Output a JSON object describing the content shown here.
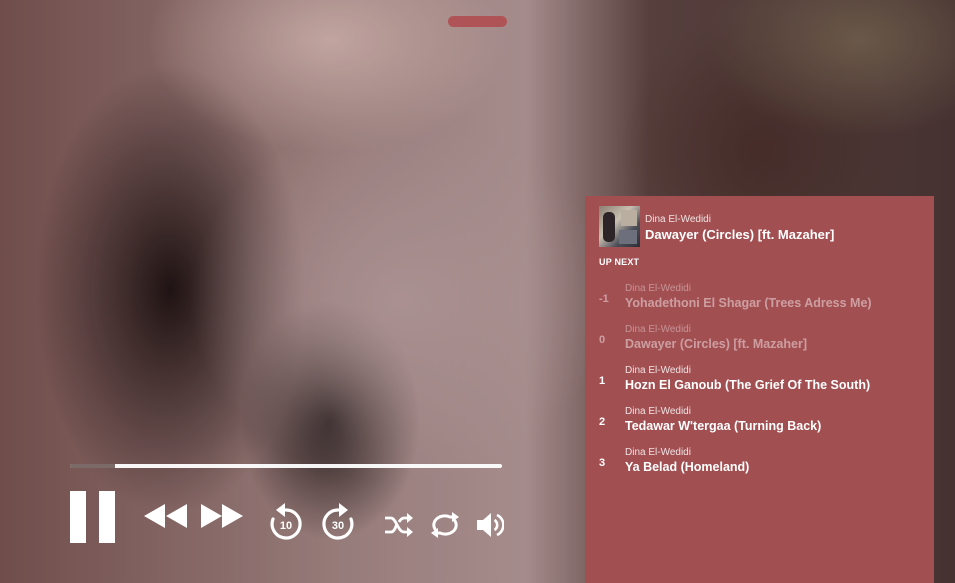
{
  "colors": {
    "accent": "#a24f52",
    "handle": "#b05356",
    "progress_track": "#ffffff",
    "progress_played": "#7c6a68"
  },
  "player": {
    "progress_fraction": 0.105,
    "controls": {
      "pause": "pause-icon",
      "rewind": "rewind-icon",
      "fast_forward": "fast-forward-icon",
      "skip_back": {
        "icon": "replay-icon",
        "label": "10"
      },
      "skip_forward": {
        "icon": "forward-icon",
        "label": "30"
      },
      "shuffle": "shuffle-icon",
      "repeat": "repeat-icon",
      "volume": "volume-icon"
    }
  },
  "now_playing": {
    "artist": "Dina El-Wedidi",
    "title": "Dawayer (Circles) [ft. Mazaher]"
  },
  "queue": {
    "heading": "UP NEXT",
    "items": [
      {
        "number": "-1",
        "artist": "Dina El-Wedidi",
        "title": "Yohadethoni El Shagar (Trees Adress Me)",
        "state": "past"
      },
      {
        "number": "0",
        "artist": "Dina El-Wedidi",
        "title": "Dawayer (Circles) [ft. Mazaher]",
        "state": "current"
      },
      {
        "number": "1",
        "artist": "Dina El-Wedidi",
        "title": "Hozn El Ganoub (The Grief Of The South)",
        "state": "upcoming"
      },
      {
        "number": "2",
        "artist": "Dina El-Wedidi",
        "title": "Tedawar W'tergaa (Turning Back)",
        "state": "upcoming"
      },
      {
        "number": "3",
        "artist": "Dina El-Wedidi",
        "title": "Ya Belad (Homeland)",
        "state": "upcoming"
      }
    ]
  }
}
